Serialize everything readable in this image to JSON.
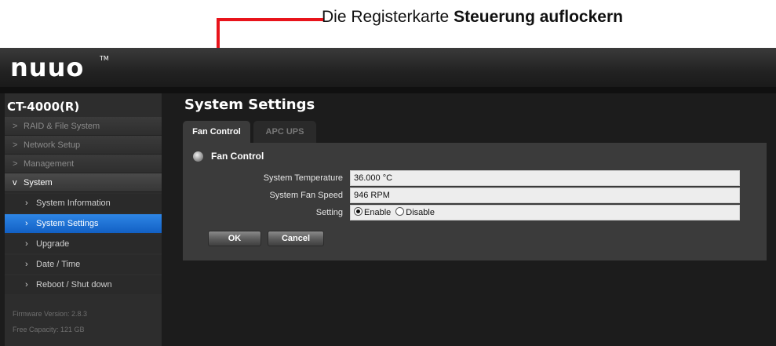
{
  "annotation": {
    "text_plain": "Die Registerkarte ",
    "text_bold": "Steuerung auflockern",
    "color": "#e8141b"
  },
  "app": {
    "logo": "nuuo",
    "logo_tm": "TM"
  },
  "sidebar": {
    "device": "CT-4000(R)",
    "items": [
      {
        "label": "RAID & File System",
        "chevron": ">"
      },
      {
        "label": "Network Setup",
        "chevron": ">"
      },
      {
        "label": "Management",
        "chevron": ">"
      },
      {
        "label": "System",
        "chevron": "v"
      }
    ],
    "sub_items": [
      {
        "label": "System Information"
      },
      {
        "label": "System Settings"
      },
      {
        "label": "Upgrade"
      },
      {
        "label": "Date / Time"
      },
      {
        "label": "Reboot / Shut down"
      }
    ],
    "sub_chevron": "›",
    "firmware": "Firmware Version: 2.8.3",
    "capacity": "Free Capacity: 121 GB"
  },
  "main": {
    "title": "System Settings",
    "tabs": [
      {
        "label": "Fan Control"
      },
      {
        "label": "APC UPS"
      }
    ],
    "section_title": "Fan Control",
    "rows": [
      {
        "label": "System Temperature",
        "value": "36.000 °C"
      },
      {
        "label": "System Fan Speed",
        "value": "946 RPM"
      },
      {
        "label": "Setting"
      }
    ],
    "radio": {
      "enable": "Enable",
      "disable": "Disable",
      "selected": "Enable"
    },
    "buttons": {
      "ok": "OK",
      "cancel": "Cancel"
    }
  },
  "colors": {
    "accent_blue": "#1f74d8",
    "background": "#1c1c1c",
    "panel": "#3b3b3b"
  }
}
